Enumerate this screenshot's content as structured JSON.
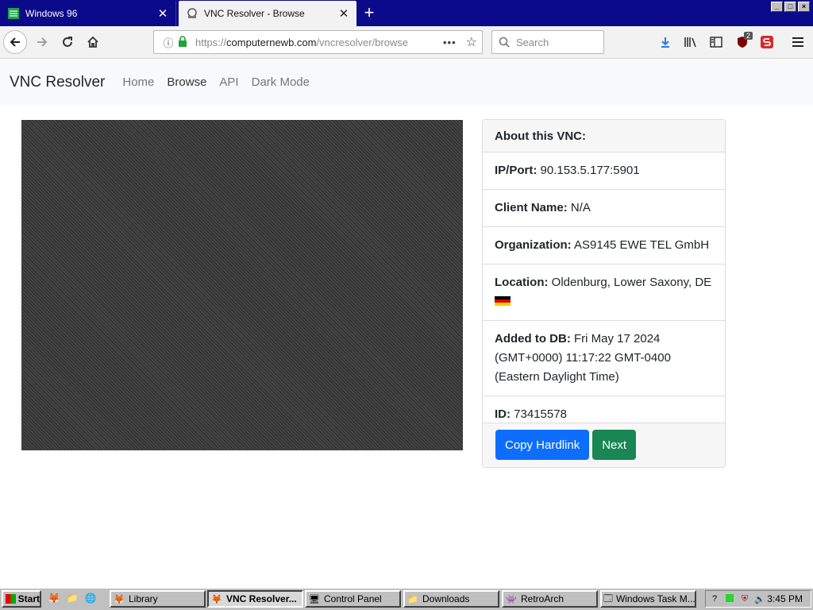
{
  "browser": {
    "tabs": [
      {
        "title": "Windows 96",
        "favicon": "windows96-icon"
      },
      {
        "title": "VNC Resolver - Browse",
        "favicon": "vnc-icon"
      }
    ],
    "new_tab_symbol": "+",
    "url": {
      "prefix": "https://",
      "domain": "computernewb.com",
      "path": "/vncresolver/browse"
    },
    "search_placeholder": "Search",
    "ublock_badge": "2",
    "window_buttons": [
      "_",
      "□",
      "×"
    ]
  },
  "site": {
    "brand": "VNC Resolver",
    "nav": [
      "Home",
      "Browse",
      "API",
      "Dark Mode"
    ]
  },
  "card": {
    "header": "About this VNC:",
    "rows": [
      {
        "label": "IP/Port:",
        "value": "90.153.5.177:5901"
      },
      {
        "label": "Client Name:",
        "value": "N/A"
      },
      {
        "label": "Organization:",
        "value": "AS9145 EWE TEL GmbH"
      },
      {
        "label": "Location:",
        "value": "Oldenburg, Lower Saxony, DE"
      },
      {
        "label": "Added to DB:",
        "value": "Fri May 17 2024 (GMT+0000) 11:17:22 GMT-0400 (Eastern Daylight Time)"
      },
      {
        "label": "ID:",
        "value": "73415578"
      }
    ],
    "buttons": {
      "copy": "Copy Hardlink",
      "next": "Next"
    }
  },
  "taskbar": {
    "start": "Start",
    "tasks": [
      "Library",
      "VNC Resolver...",
      "Control Panel",
      "Downloads",
      "RetroArch",
      "Windows Task M..."
    ],
    "clock": "3:45 PM"
  },
  "colors": {
    "title_bar": "#0a0a8a",
    "primary": "#0d6efd",
    "success": "#198754",
    "taskbar": "#c0c0c0"
  }
}
